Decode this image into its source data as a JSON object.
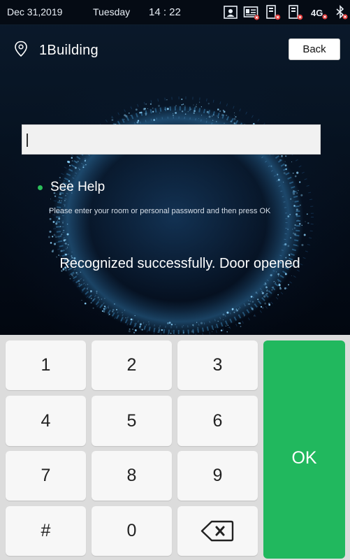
{
  "status_bar": {
    "date": "Dec 31,2019",
    "day": "Tuesday",
    "time": "14 : 22",
    "network": "4G",
    "icons": [
      "face-recognition-icon",
      "id-card-error-icon",
      "card-reader-error-icon",
      "card-reader-error-icon",
      "network-4g-icon",
      "bluetooth-error-icon"
    ]
  },
  "header": {
    "location": "1Building",
    "back_label": "Back"
  },
  "input": {
    "value": ""
  },
  "help": {
    "label": "See Help",
    "instruction": "Please enter your room or personal password and then press OK"
  },
  "message": "Recognized successfully. Door opened",
  "keypad": {
    "keys": [
      "1",
      "2",
      "3",
      "4",
      "5",
      "6",
      "7",
      "8",
      "9",
      "#",
      "0"
    ],
    "backspace_icon": "backspace-icon",
    "ok_label": "OK"
  },
  "colors": {
    "ok_green": "#21b85e",
    "help_dot": "#2bbf5a",
    "error_red": "#e23b3b",
    "background_dark": "#071423"
  }
}
